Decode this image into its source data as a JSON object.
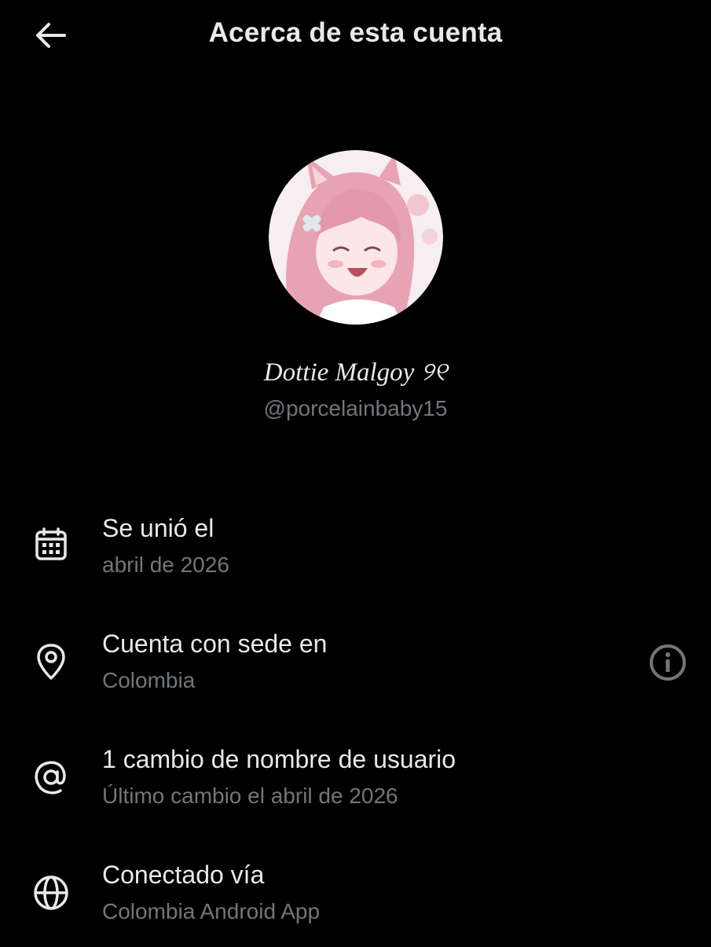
{
  "header": {
    "title": "Acerca de esta cuenta",
    "back_icon": "arrow-left-icon"
  },
  "profile": {
    "display_name": "Dottie Malgoy ୨୧",
    "handle": "@porcelainbaby15",
    "avatar_description_icon": "avatar-image"
  },
  "rows": [
    {
      "icon": "calendar-icon",
      "label": "Se unió el",
      "value": "abril de 2026"
    },
    {
      "icon": "location-pin-icon",
      "label": "Cuenta con sede en",
      "value": "Colombia",
      "action_icon": "info-icon"
    },
    {
      "icon": "at-sign-icon",
      "label": "1 cambio de nombre de usuario",
      "value": "Último cambio el abril de 2026"
    },
    {
      "icon": "globe-icon",
      "label": "Conectado vía",
      "value": "Colombia Android App"
    }
  ],
  "colors": {
    "background": "#000000",
    "primary_text": "#e7e9ea",
    "secondary_text": "#71767b"
  }
}
